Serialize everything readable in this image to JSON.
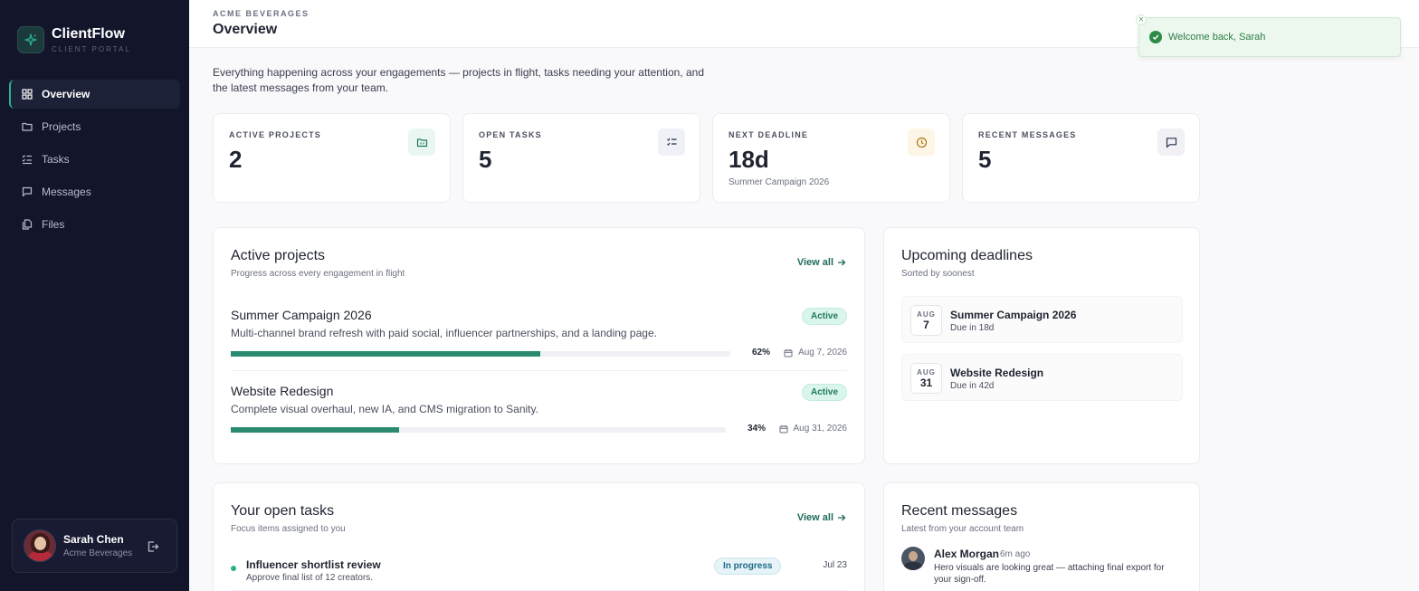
{
  "brand": {
    "name": "ClientFlow",
    "subtitle": "CLIENT PORTAL",
    "accent": "#2bb08f"
  },
  "nav": [
    {
      "label": "Overview",
      "icon": "grid-icon",
      "active": true
    },
    {
      "label": "Projects",
      "icon": "folder-icon",
      "active": false
    },
    {
      "label": "Tasks",
      "icon": "checklist-icon",
      "active": false
    },
    {
      "label": "Messages",
      "icon": "message-icon",
      "active": false
    },
    {
      "label": "Files",
      "icon": "files-icon",
      "active": false
    }
  ],
  "user": {
    "name": "Sarah Chen",
    "org": "Acme Beverages"
  },
  "header": {
    "org_label": "ACME BEVERAGES",
    "title": "Overview"
  },
  "toast": {
    "text": "Welcome back, Sarah",
    "close": "✕"
  },
  "intro": "Everything happening across your engagements — projects in flight, tasks needing your attention, and the latest messages from your team.",
  "stats": [
    {
      "label": "ACTIVE PROJECTS",
      "value": "2",
      "sub": "",
      "icon": "folder-icon",
      "icon_bg": "#eaf6f2",
      "icon_color": "#1f7a5f"
    },
    {
      "label": "OPEN TASKS",
      "value": "5",
      "sub": "",
      "icon": "checklist-icon",
      "icon_bg": "#eef1f6",
      "icon_color": "#2a3550"
    },
    {
      "label": "NEXT DEADLINE",
      "value": "18d",
      "sub": "Summer Campaign 2026",
      "icon": "clock-icon",
      "icon_bg": "#fdf6e6",
      "icon_color": "#a8770e"
    },
    {
      "label": "RECENT MESSAGES",
      "value": "5",
      "sub": "",
      "icon": "message-icon",
      "icon_bg": "#f1f1f5",
      "icon_color": "#2a3550"
    }
  ],
  "active_projects": {
    "title": "Active projects",
    "subtitle": "Progress across every engagement in flight",
    "view_all": "View all",
    "items": [
      {
        "name": "Summer Campaign 2026",
        "desc": "Multi-channel brand refresh with paid social, influencer partnerships, and a landing page.",
        "status": "Active",
        "progress": 0.62,
        "progress_label": "62%",
        "due": "Aug 7, 2026"
      },
      {
        "name": "Website Redesign",
        "desc": "Complete visual overhaul, new IA, and CMS migration to Sanity.",
        "status": "Active",
        "progress": 0.34,
        "progress_label": "34%",
        "due": "Aug 31, 2026"
      }
    ]
  },
  "deadlines": {
    "title": "Upcoming deadlines",
    "subtitle": "Sorted by soonest",
    "items": [
      {
        "month": "AUG",
        "day": "7",
        "name": "Summer Campaign 2026",
        "due": "Due in 18d"
      },
      {
        "month": "AUG",
        "day": "31",
        "name": "Website Redesign",
        "due": "Due in 42d"
      }
    ]
  },
  "tasks": {
    "title": "Your open tasks",
    "subtitle": "Focus items assigned to you",
    "view_all": "View all",
    "items": [
      {
        "name": "Influencer shortlist review",
        "sub": "Approve final list of 12 creators.",
        "status": "In progress",
        "date": "Jul 23"
      }
    ]
  },
  "messages": {
    "title": "Recent messages",
    "subtitle": "Latest from your account team",
    "items": [
      {
        "name": "Alex Morgan",
        "time": "6m ago",
        "text": "Hero visuals are looking great — attaching final export for your sign-off."
      }
    ]
  }
}
